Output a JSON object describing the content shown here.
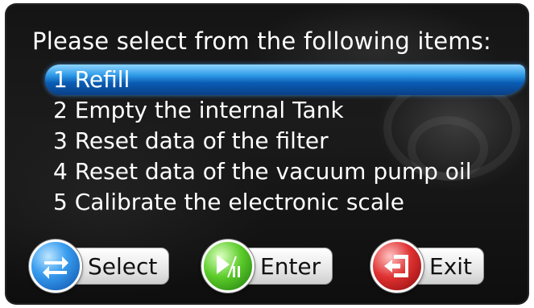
{
  "screen": {
    "title": "Please select from the following items:"
  },
  "menu": {
    "items": [
      {
        "label": "1 Refill",
        "selected": true
      },
      {
        "label": "2 Empty the internal Tank",
        "selected": false
      },
      {
        "label": "3 Reset data of the filter",
        "selected": false
      },
      {
        "label": "4 Reset data of the vacuum pump oil",
        "selected": false
      },
      {
        "label": "5 Calibrate the electronic scale",
        "selected": false
      }
    ]
  },
  "buttons": {
    "select": {
      "label": "Select",
      "icon": "swap-arrows-icon",
      "color": "#2f8fe6"
    },
    "enter": {
      "label": "Enter",
      "icon": "play-pause-icon",
      "color": "#4cbf22"
    },
    "exit": {
      "label": "Exit",
      "icon": "exit-door-icon",
      "color": "#d42828"
    }
  },
  "colors": {
    "selection_highlight": "#2f9be8",
    "background": "#141414",
    "text": "#ffffff"
  }
}
